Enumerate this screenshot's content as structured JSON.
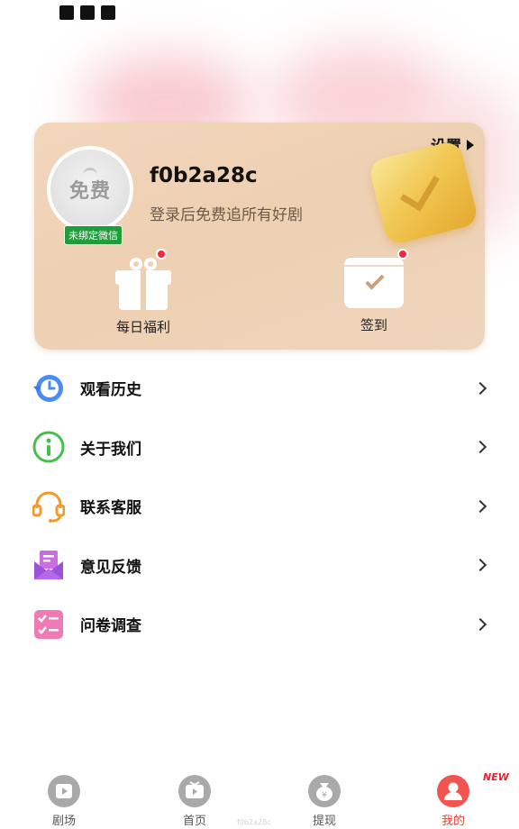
{
  "card": {
    "settings_label": "设置",
    "avatar_text": "免费",
    "wechat_badge": "未绑定微信",
    "username": "f0b2a28c",
    "tagline": "登录后免费追所有好剧",
    "features": [
      {
        "label": "每日福利",
        "icon": "gift-icon",
        "has_dot": true
      },
      {
        "label": "签到",
        "icon": "calendar-check-icon",
        "has_dot": true
      }
    ]
  },
  "menu": {
    "items": [
      {
        "label": "观看历史",
        "icon": "history-clock-icon"
      },
      {
        "label": "关于我们",
        "icon": "info-icon"
      },
      {
        "label": "联系客服",
        "icon": "headset-icon"
      },
      {
        "label": "意见反馈",
        "icon": "feedback-envelope-icon"
      },
      {
        "label": "问卷调查",
        "icon": "checklist-icon"
      }
    ]
  },
  "tabs": {
    "items": [
      {
        "label": "剧场",
        "icon": "theater-icon",
        "active": false
      },
      {
        "label": "首页",
        "icon": "tv-play-icon",
        "active": false
      },
      {
        "label": "提现",
        "icon": "money-bag-icon",
        "active": false
      },
      {
        "label": "我的",
        "icon": "user-icon",
        "active": true
      }
    ],
    "new_badge": "NEW"
  },
  "watermark": "f0b2a28c",
  "colors": {
    "card_bg": "#eed0b2",
    "accent_red": "#e2453f",
    "wechat_green": "#1f9d3a",
    "notify_dot": "#f22b3c"
  }
}
